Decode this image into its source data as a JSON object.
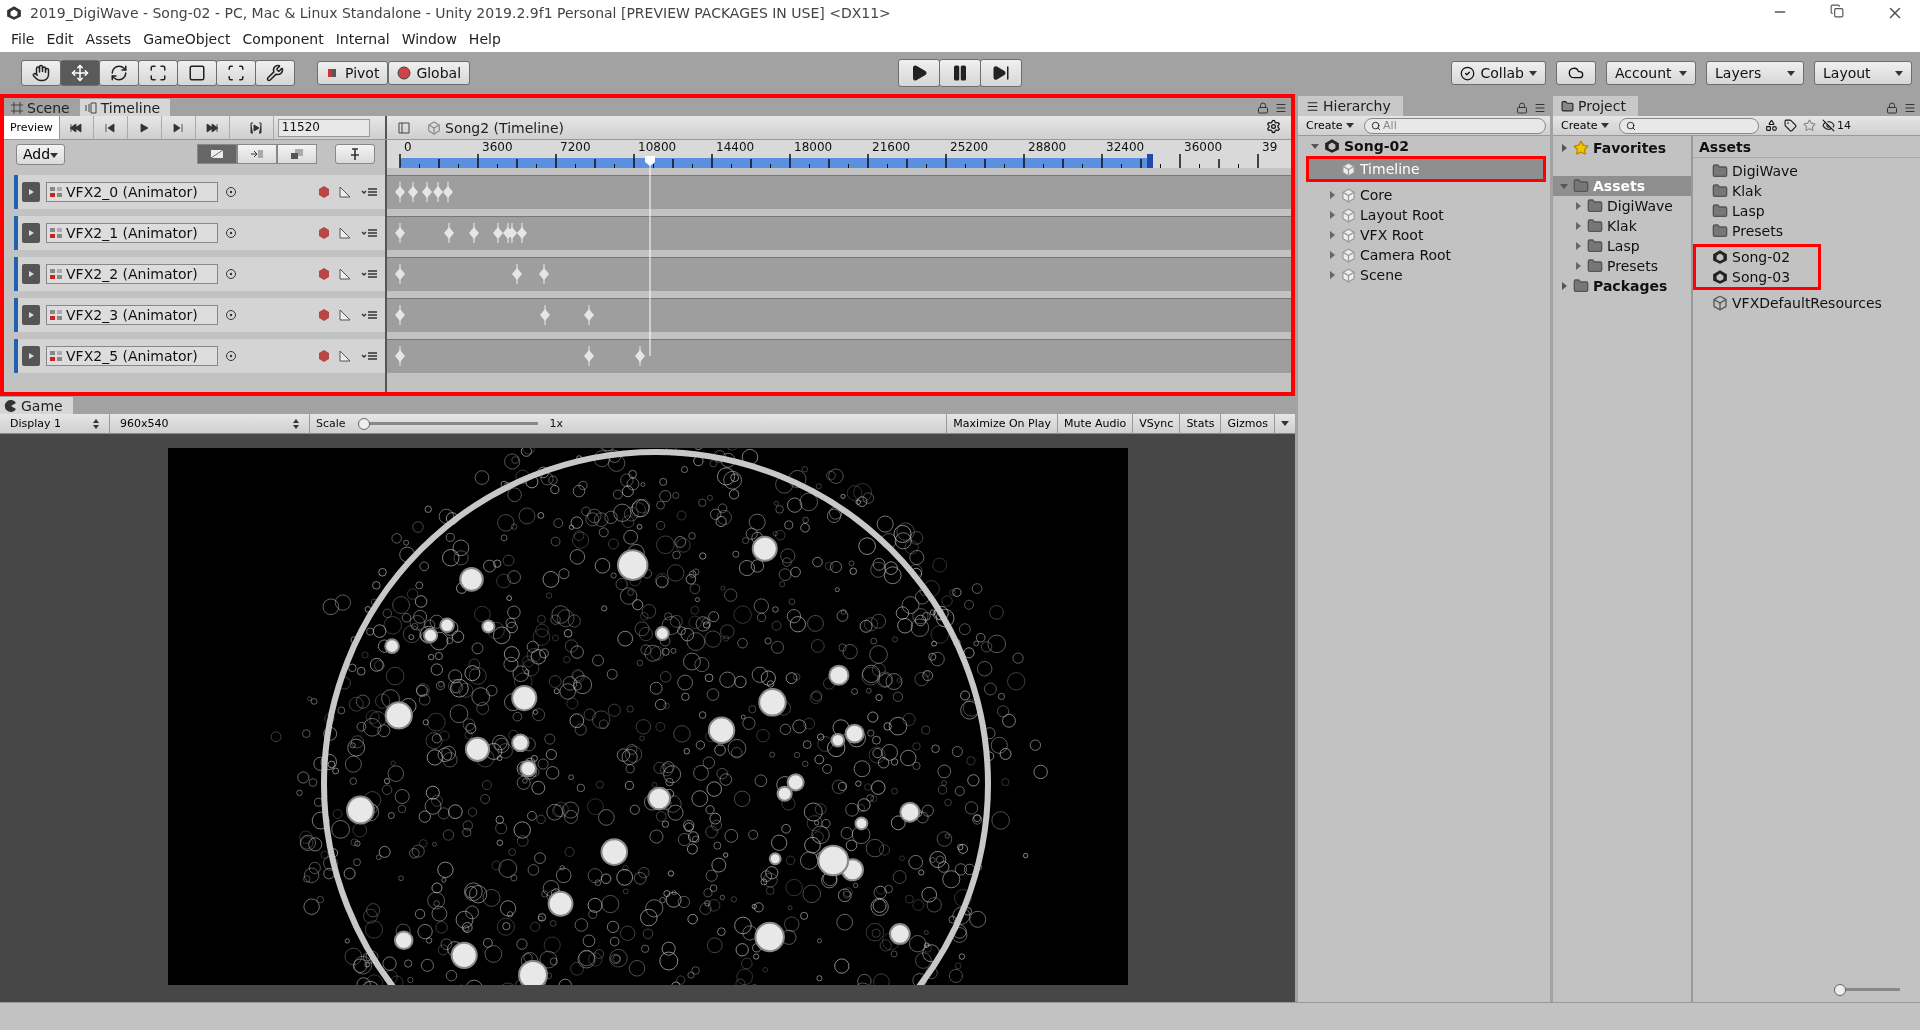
{
  "window": {
    "title": "2019_DigiWave - Song-02 - PC, Mac & Linux Standalone - Unity 2019.2.9f1 Personal [PREVIEW PACKAGES IN USE] <DX11>"
  },
  "menu": [
    "File",
    "Edit",
    "Assets",
    "GameObject",
    "Component",
    "Internal",
    "Window",
    "Help"
  ],
  "toolbar": {
    "tools": [
      {
        "kind": "hand",
        "selected": false
      },
      {
        "kind": "move",
        "selected": true
      },
      {
        "kind": "rotate",
        "selected": false
      },
      {
        "kind": "scale",
        "selected": false
      },
      {
        "kind": "rect",
        "selected": false
      },
      {
        "kind": "transform",
        "selected": false
      },
      {
        "kind": "custom",
        "selected": false
      }
    ],
    "pivot": "Pivot",
    "global": "Global",
    "transport": [
      {
        "kind": "play",
        "on": false
      },
      {
        "kind": "pause",
        "on": false
      },
      {
        "kind": "step",
        "on": false
      }
    ],
    "collab": "Collab",
    "account": "Account",
    "layers": "Layers",
    "layout": "Layout"
  },
  "timeline_panel": {
    "highlighted": true,
    "tabs": [
      {
        "label": "Scene",
        "kind": "scene",
        "selected": false
      },
      {
        "label": "Timeline",
        "kind": "timeline",
        "selected": true
      }
    ],
    "preview": {
      "label": "Preview",
      "selected": true
    },
    "frame": "11520",
    "breadcrumb": "Song2 (Timeline)",
    "add": "Add",
    "ruler": [
      "0",
      "3600",
      "7200",
      "10800",
      "14400",
      "18000",
      "21600",
      "25200",
      "28800",
      "32400",
      "36000",
      "39"
    ],
    "tracks": [
      {
        "name": "VFX2_0 (Animator)"
      },
      {
        "name": "VFX2_1 (Animator)"
      },
      {
        "name": "VFX2_2 (Animator)"
      },
      {
        "name": "VFX2_3 (Animator)"
      },
      {
        "name": "VFX2_5 (Animator)"
      }
    ]
  },
  "game_panel": {
    "tab": "Game",
    "display": "Display 1",
    "resolution": "960x540",
    "scale_label": "Scale",
    "scale": {
      "level": 0
    },
    "scale_value": "1x",
    "toggles": [
      {
        "label": "Maximize On Play",
        "on": false
      },
      {
        "label": "Mute Audio",
        "on": false
      },
      {
        "label": "VSync",
        "on": false
      },
      {
        "label": "Stats",
        "on": false
      },
      {
        "label": "Gizmos",
        "on": false
      }
    ]
  },
  "hierarchy": {
    "title": "Hierarchy",
    "create": "Create",
    "search_placeholder": "All",
    "scene": {
      "name": "Song-02",
      "expanded": true,
      "children": [
        {
          "name": "Timeline",
          "selected": true,
          "highlighted": true,
          "has_children": false
        },
        {
          "name": "Core",
          "selected": false,
          "highlighted": false,
          "has_children": true
        },
        {
          "name": "Layout Root",
          "selected": false,
          "highlighted": false,
          "has_children": true
        },
        {
          "name": "VFX Root",
          "selected": false,
          "highlighted": false,
          "has_children": true
        },
        {
          "name": "Camera Root",
          "selected": false,
          "highlighted": false,
          "has_children": true
        },
        {
          "name": "Scene",
          "selected": false,
          "highlighted": false,
          "has_children": true
        }
      ]
    }
  },
  "project": {
    "title": "Project",
    "create": "Create",
    "hidden_count": "14",
    "tree": [
      {
        "name": "Favorites",
        "kind": "favorites",
        "expanded": false,
        "selected": false
      },
      {
        "name": "Assets",
        "kind": "folder",
        "expanded": true,
        "selected": true,
        "children": [
          {
            "name": "DigiWave"
          },
          {
            "name": "Klak"
          },
          {
            "name": "Lasp"
          },
          {
            "name": "Presets"
          }
        ]
      },
      {
        "name": "Packages",
        "kind": "folder",
        "expanded": false,
        "selected": false
      }
    ],
    "list_title": "Assets",
    "items": [
      {
        "name": "DigiWave",
        "kind": "folder",
        "highlighted": false
      },
      {
        "name": "Klak",
        "kind": "folder",
        "highlighted": false
      },
      {
        "name": "Lasp",
        "kind": "folder",
        "highlighted": false
      },
      {
        "name": "Presets",
        "kind": "folder",
        "highlighted": false
      },
      {
        "name": "Song-02",
        "kind": "scene",
        "highlighted": true
      },
      {
        "name": "Song-03",
        "kind": "scene",
        "highlighted": true
      },
      {
        "name": "VFXDefaultResources",
        "kind": "resource",
        "highlighted": false
      }
    ],
    "icon_size": {
      "level": 0
    }
  }
}
